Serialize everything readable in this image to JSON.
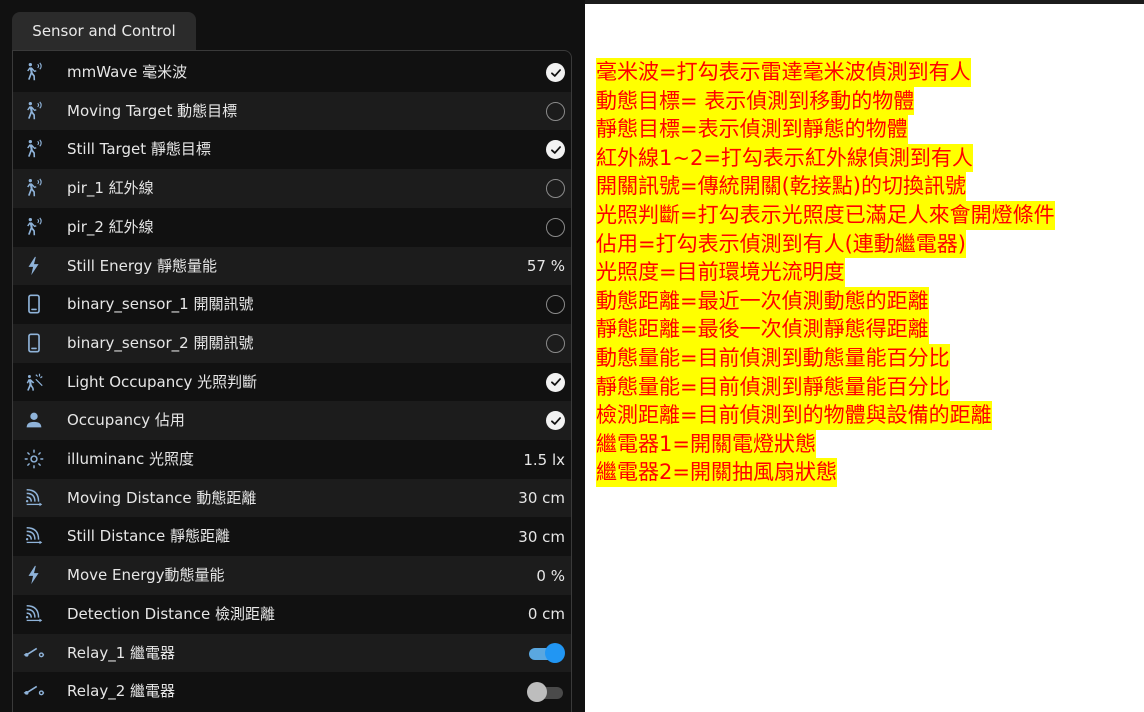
{
  "panel": {
    "tab_label": "Sensor and Control",
    "rows": [
      {
        "label": "mmWave 毫米波",
        "icon": "motion-sensor-icon",
        "state": "checked"
      },
      {
        "label": "Moving Target 動態目標",
        "icon": "motion-sensor-icon",
        "state": "unchecked"
      },
      {
        "label": "Still Target 靜態目標",
        "icon": "motion-sensor-icon",
        "state": "checked"
      },
      {
        "label": "pir_1 紅外線",
        "icon": "motion-sensor-icon",
        "state": "unchecked"
      },
      {
        "label": "pir_2 紅外線",
        "icon": "motion-sensor-icon",
        "state": "unchecked"
      },
      {
        "label": "Still Energy 靜態量能",
        "icon": "lightning-bolt-icon",
        "state": "value",
        "value": "57 %"
      },
      {
        "label": "binary_sensor_1 開關訊號",
        "icon": "phone-device-icon",
        "state": "unchecked"
      },
      {
        "label": "binary_sensor_2 開關訊號",
        "icon": "phone-device-icon",
        "state": "unchecked"
      },
      {
        "label": "Light Occupancy 光照判斷",
        "icon": "light-occupancy-icon",
        "state": "checked"
      },
      {
        "label": "Occupancy 佔用",
        "icon": "person-icon",
        "state": "checked"
      },
      {
        "label": "illuminanc 光照度",
        "icon": "brightness-icon",
        "state": "value",
        "value": "1.5 lx"
      },
      {
        "label": "Moving Distance 動態距離",
        "icon": "signal-distance-icon",
        "state": "value",
        "value": "30 cm"
      },
      {
        "label": "Still Distance 靜態距離",
        "icon": "signal-distance-icon",
        "state": "value",
        "value": "30 cm"
      },
      {
        "label": "Move Energy動態量能",
        "icon": "lightning-bolt-icon",
        "state": "value",
        "value": "0 %"
      },
      {
        "label": "Detection Distance 檢測距離",
        "icon": "signal-distance-icon",
        "state": "value",
        "value": "0 cm"
      },
      {
        "label": "Relay_1 繼電器",
        "icon": "switch-icon",
        "state": "toggle-on"
      },
      {
        "label": "Relay_2 繼電器",
        "icon": "switch-icon",
        "state": "toggle-off"
      }
    ]
  },
  "notes": [
    "毫米波=打勾表示雷達毫米波偵測到有人",
    "動態目標= 表示偵測到移動的物體",
    "靜態目標=表示偵測到靜態的物體",
    "紅外線1~2=打勾表示紅外線偵測到有人",
    "開關訊號=傳統開關(乾接點)的切換訊號",
    "光照判斷=打勾表示光照度已滿足人來會開燈條件",
    "佔用=打勾表示偵測到有人(連動繼電器)",
    "光照度=目前環境光流明度",
    "動態距離=最近一次偵測動態的距離",
    "靜態距離=最後一次偵測靜態得距離",
    "動態量能=目前偵測到動態量能百分比",
    "靜態量能=目前偵測到靜態量能百分比",
    "檢測距離=目前偵測到的物體與設備的距離",
    "繼電器1=開關電燈狀態",
    "繼電器2=開關抽風扇狀態"
  ],
  "colors": {
    "panel_bg": "#111111",
    "row_alt_bg": "#1c1c1c",
    "toggle_on": "#2196f3",
    "note_bg": "#ffff00",
    "note_text": "#ff0000"
  }
}
